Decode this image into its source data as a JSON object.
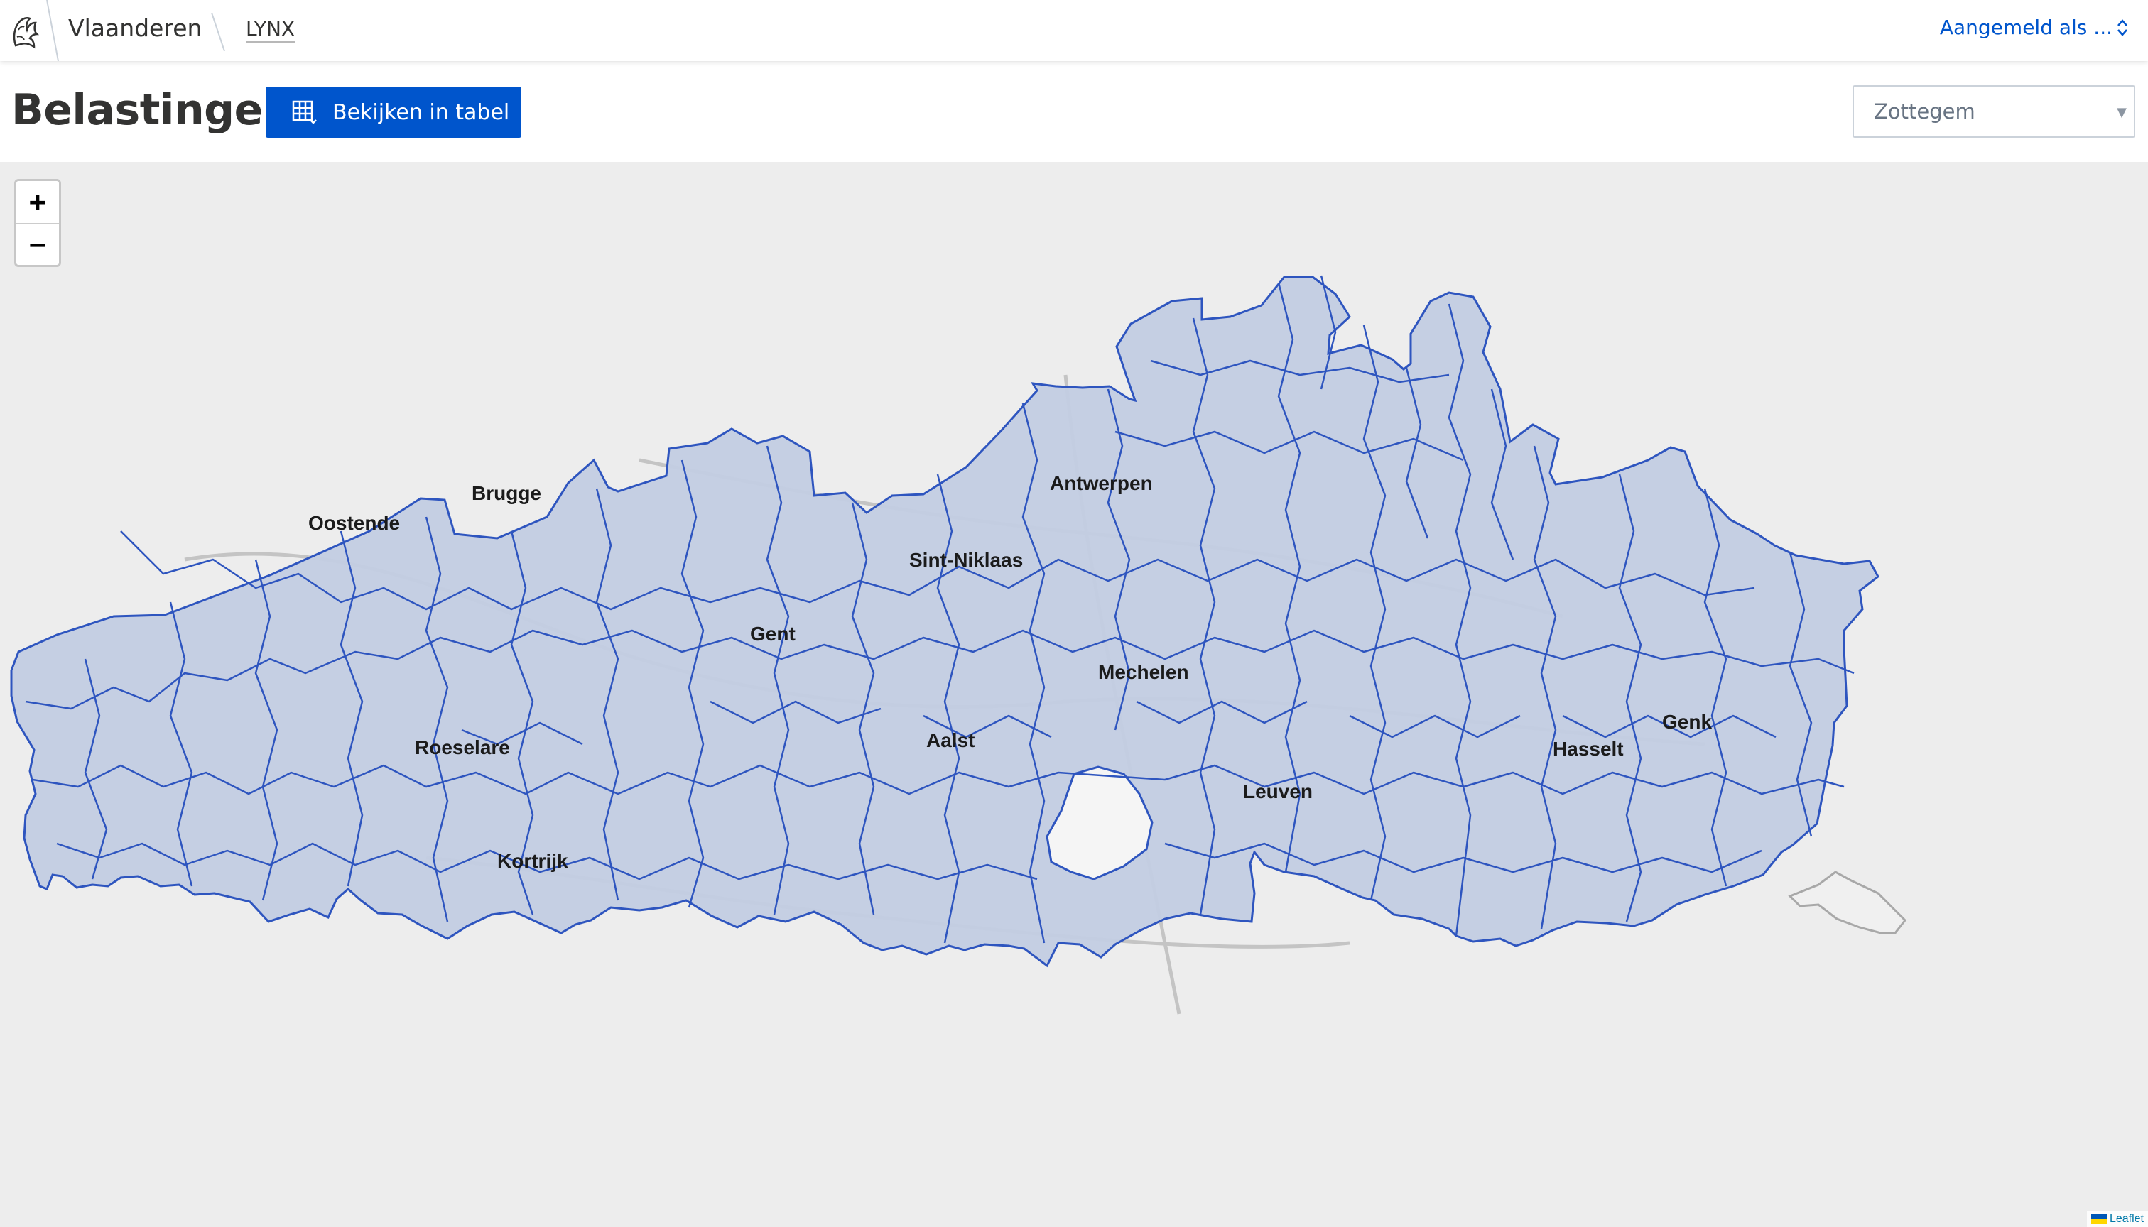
{
  "header": {
    "brand": "Vlaanderen",
    "app": "LYNX",
    "login": "Aangemeld als ..."
  },
  "page": {
    "title": "Belastingen",
    "table_button": "Bekijken in tabel",
    "select_value": "Zottegem"
  },
  "map": {
    "zoom_in": "+",
    "zoom_out": "−",
    "attribution": "Leaflet",
    "fill_color": "#c3cde3",
    "border_color": "#2e55bf",
    "cities": [
      "Brugge",
      "Oostende",
      "Antwerpen",
      "Sint-Niklaas",
      "Gent",
      "Mechelen",
      "Aalst",
      "Roeselare",
      "Hasselt",
      "Genk",
      "Leuven",
      "Kortrijk"
    ]
  }
}
